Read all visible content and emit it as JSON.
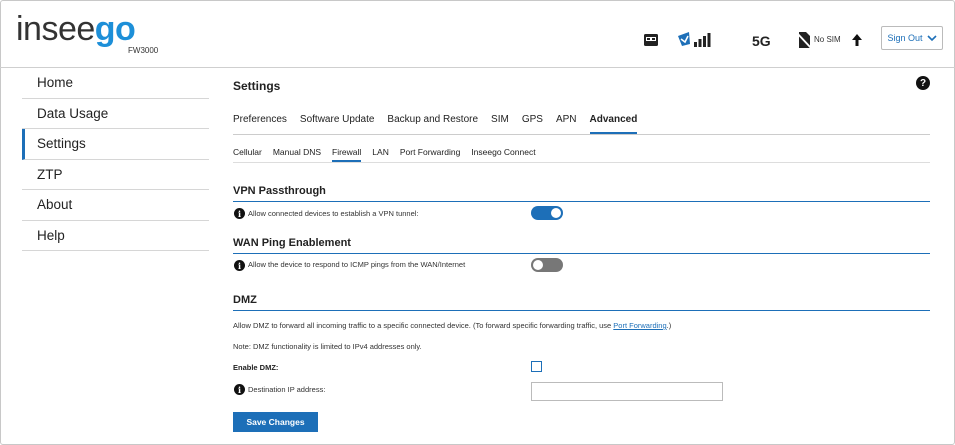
{
  "header": {
    "logo_part1": "insee",
    "logo_part2": "go",
    "model": "FW3000",
    "network_type": "5G",
    "sim_status": "No SIM",
    "signout_label": "Sign Out"
  },
  "sidebar": {
    "items": [
      {
        "label": "Home"
      },
      {
        "label": "Data Usage"
      },
      {
        "label": "Settings"
      },
      {
        "label": "ZTP"
      },
      {
        "label": "About"
      },
      {
        "label": "Help"
      }
    ],
    "active_index": 2
  },
  "main": {
    "title": "Settings",
    "tabs": [
      {
        "label": "Preferences"
      },
      {
        "label": "Software Update"
      },
      {
        "label": "Backup and Restore"
      },
      {
        "label": "SIM"
      },
      {
        "label": "GPS"
      },
      {
        "label": "APN"
      },
      {
        "label": "Advanced"
      }
    ],
    "subtabs": [
      {
        "label": "Cellular"
      },
      {
        "label": "Manual DNS"
      },
      {
        "label": "Firewall"
      },
      {
        "label": "LAN"
      },
      {
        "label": "Port Forwarding"
      },
      {
        "label": "Inseego Connect"
      }
    ],
    "vpn": {
      "title": "VPN Passthrough",
      "description": "Allow connected devices to establish a VPN tunnel:",
      "enabled": true
    },
    "wan_ping": {
      "title": "WAN Ping Enablement",
      "description": "Allow the device to respond to ICMP pings from the WAN/Internet",
      "enabled": false
    },
    "dmz": {
      "title": "DMZ",
      "description_prefix": "Allow DMZ to forward all incoming traffic to a specific connected device. (To forward specific forwarding traffic, use ",
      "description_link": "Port Forwarding",
      "description_suffix": ".)",
      "note": "Note: DMZ functionality is limited to IPv4 addresses only.",
      "enable_label": "Enable DMZ:",
      "enable_checked": false,
      "ip_label": "Destination IP address:",
      "ip_value": ""
    },
    "save_label": "Save Changes"
  },
  "colors": {
    "accent": "#1d6fb8",
    "logo_blue": "#1d8fd8",
    "toggle_off": "#777777"
  }
}
